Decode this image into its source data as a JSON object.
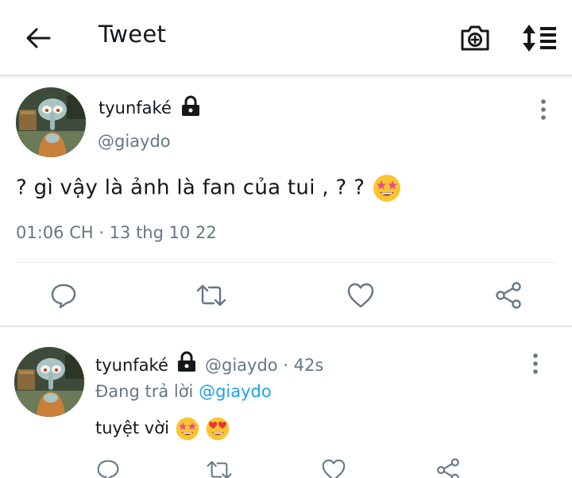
{
  "header": {
    "title": "Tweet",
    "back_icon": "back-arrow-icon",
    "camera_icon": "camera-add-icon",
    "sort_icon": "sort-list-icon"
  },
  "main_tweet": {
    "display_name": "tyunfaké",
    "handle": "@giaydo",
    "text": "?  gì vậy là ảnh là fan của tui , ? ?",
    "timestamp": "01:06 CH · 13 thg 10 22",
    "protected_icon": "lock-icon",
    "emoji": "star-struck-emoji"
  },
  "reply_tweet": {
    "display_name": "tyunfaké",
    "meta": "@giaydo · 42s",
    "replying_prefix": "Đang trả lời",
    "replying_to": "@giaydo",
    "text": "tuyệt vời",
    "emojis": [
      "star-struck-emoji",
      "heart-eyes-emoji"
    ]
  },
  "actions": [
    "reply-icon",
    "retweet-icon",
    "like-icon",
    "share-icon"
  ],
  "colors": {
    "text": "#14171a",
    "secondary": "#657786",
    "accent": "#1da1f2",
    "divider": "#e6ecf0"
  }
}
